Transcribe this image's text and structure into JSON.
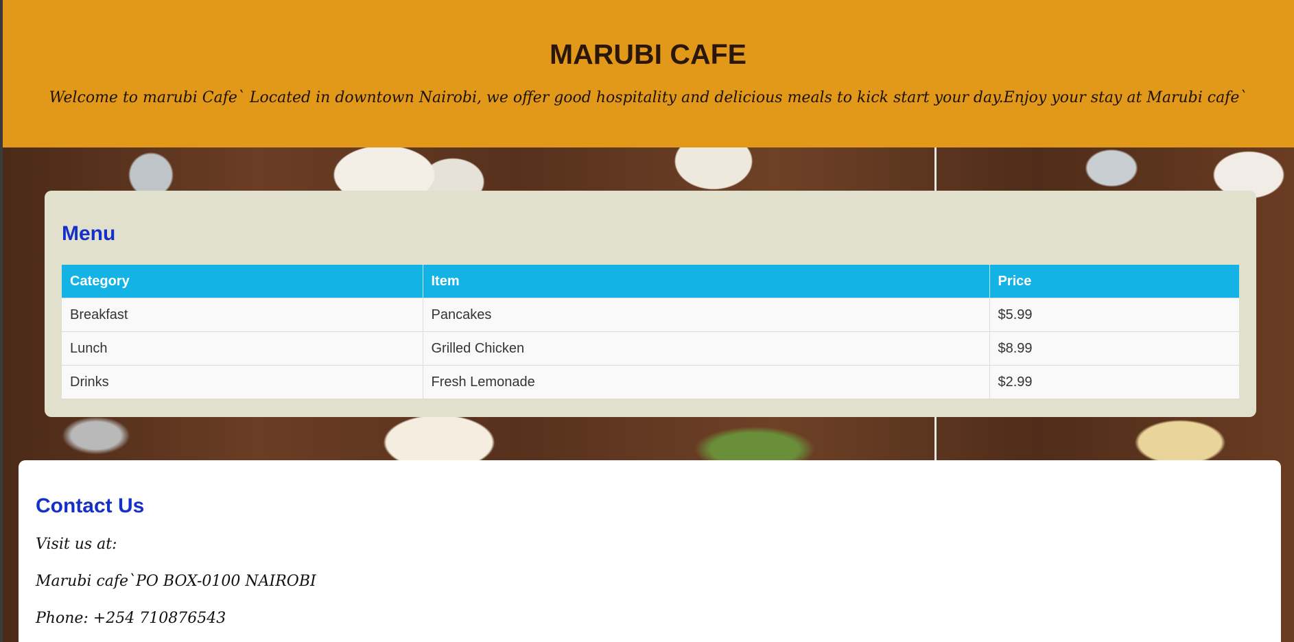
{
  "header": {
    "title": "MARUBI CAFE",
    "tagline": "Welcome to marubi Cafe` Located in downtown Nairobi, we offer good hospitality and delicious meals to kick start your day.Enjoy your stay at Marubi cafe`"
  },
  "menu": {
    "heading": "Menu",
    "columns": [
      "Category",
      "Item",
      "Price"
    ],
    "rows": [
      [
        "Breakfast",
        "Pancakes",
        "$5.99"
      ],
      [
        "Lunch",
        "Grilled Chicken",
        "$8.99"
      ],
      [
        "Drinks",
        "Fresh Lemonade",
        "$2.99"
      ]
    ]
  },
  "contact": {
    "heading": "Contact Us",
    "visit_label": "Visit us at:",
    "address": "Marubi cafe`PO BOX-0100 NAIROBI",
    "phone": "Phone: +254 710876543"
  },
  "colors": {
    "header_bg": "#e29818",
    "heading_blue": "#1530c8",
    "table_header_bg": "#13b3e6",
    "menu_card_bg": "#e1e0cc"
  }
}
